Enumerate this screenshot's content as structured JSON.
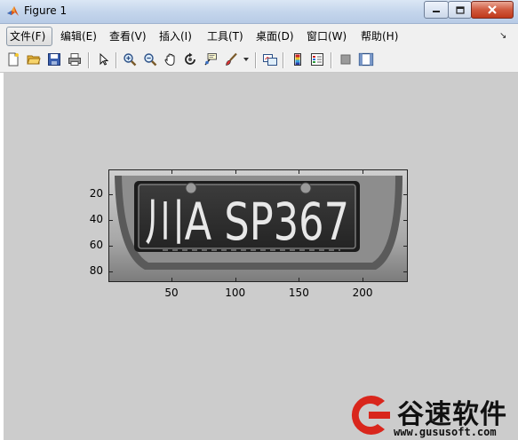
{
  "window": {
    "title": "Figure 1"
  },
  "menu": {
    "items": [
      "文件(F)",
      "编辑(E)",
      "查看(V)",
      "插入(I)",
      "工具(T)",
      "桌面(D)",
      "窗口(W)",
      "帮助(H)"
    ],
    "active_index": 0
  },
  "toolbar": {
    "icons": [
      "new-figure-icon",
      "open-file-icon",
      "save-icon",
      "print-icon",
      "edit-plot-arrow-icon",
      "zoom-in-icon",
      "zoom-out-icon",
      "pan-hand-icon",
      "rotate-3d-icon",
      "data-cursor-icon",
      "brush-icon",
      "brush-dropdown-icon",
      "link-plot-icon",
      "insert-colorbar-icon",
      "insert-legend-icon",
      "hide-plot-tools-icon",
      "show-plot-tools-icon"
    ]
  },
  "figure": {
    "image_text": "川A SP367",
    "x_ticks": [
      "50",
      "100",
      "150",
      "200"
    ],
    "y_ticks": [
      "20",
      "40",
      "60",
      "80"
    ],
    "x_tick_values": [
      50,
      100,
      150,
      200
    ],
    "y_tick_values": [
      20,
      40,
      60,
      80
    ],
    "x_range": [
      0.5,
      235.5
    ],
    "y_range": [
      0.5,
      88.5
    ]
  },
  "watermark": {
    "name": "谷速软件",
    "url": "www.gususoft.com",
    "brand_color": "#d9261c"
  }
}
